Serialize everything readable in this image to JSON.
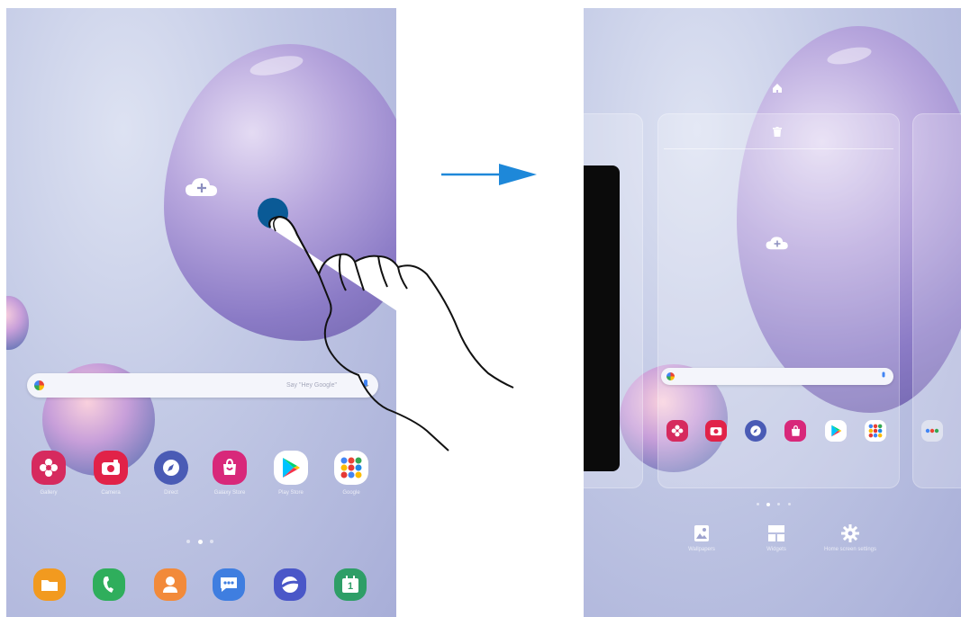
{
  "left_screen": {
    "search_hint": "Say \"Hey Google\"",
    "apps_row1": [
      {
        "label": "Gallery",
        "icon": "gallery-icon",
        "color": "#d62a5e"
      },
      {
        "label": "Camera",
        "icon": "camera-icon",
        "color": "#e12248"
      },
      {
        "label": "Direct",
        "icon": "compass-icon",
        "color": "#4a5bb5"
      },
      {
        "label": "Galaxy Store",
        "icon": "store-icon",
        "color": "#d8287a"
      },
      {
        "label": "Play Store",
        "icon": "play-store-icon",
        "color": "#ffffff"
      },
      {
        "label": "Google",
        "icon": "google-folder-icon",
        "color": "#ffffff"
      }
    ],
    "apps_dock": [
      {
        "label": "My Files",
        "icon": "folder-icon",
        "color": "#f29a1f"
      },
      {
        "label": "Phone",
        "icon": "phone-icon",
        "color": "#2fae5c"
      },
      {
        "label": "Contacts",
        "icon": "contacts-icon",
        "color": "#f28a3a"
      },
      {
        "label": "Messages",
        "icon": "messages-icon",
        "color": "#3f7ee0"
      },
      {
        "label": "Internet",
        "icon": "internet-icon",
        "color": "#4a57c8"
      },
      {
        "label": "Calendar",
        "icon": "calendar-icon",
        "color": "#2e9e67"
      }
    ],
    "calendar_day": "1"
  },
  "right_screen": {
    "panel_options": [
      {
        "label": "Wallpapers",
        "icon": "wallpaper-icon"
      },
      {
        "label": "Widgets",
        "icon": "widgets-icon"
      },
      {
        "label": "Home screen settings",
        "icon": "gear-icon"
      }
    ],
    "apps_row": [
      {
        "icon": "gallery-icon",
        "color": "#d62a5e"
      },
      {
        "icon": "camera-icon",
        "color": "#e12248"
      },
      {
        "icon": "compass-icon",
        "color": "#4a5bb5"
      },
      {
        "icon": "store-icon",
        "color": "#d8287a"
      },
      {
        "icon": "play-store-icon",
        "color": "#ffffff"
      },
      {
        "icon": "google-folder-icon",
        "color": "#ffffff"
      }
    ]
  },
  "arrow_color": "#1e88d9",
  "touch_dot_color": "#0a5a96"
}
